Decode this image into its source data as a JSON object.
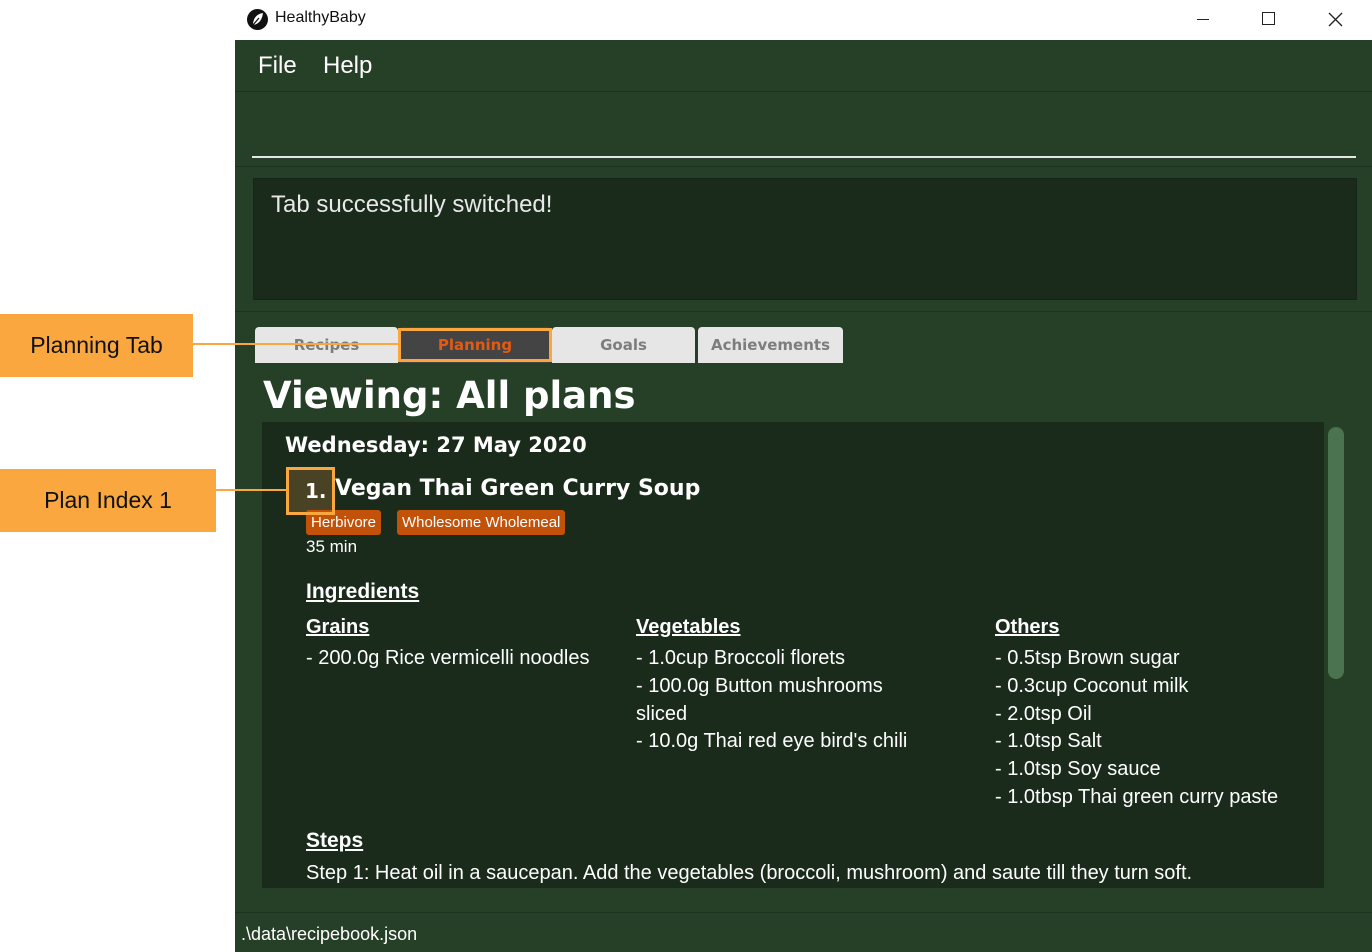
{
  "window": {
    "title": "HealthyBaby",
    "icon": "leaf-icon"
  },
  "menu": {
    "file": "File",
    "help": "Help"
  },
  "command": {
    "value": ""
  },
  "result": {
    "message": "Tab successfully switched!"
  },
  "tabs": [
    {
      "label": "Recipes",
      "selected": false
    },
    {
      "label": "Planning",
      "selected": true
    },
    {
      "label": "Goals",
      "selected": false
    },
    {
      "label": "Achievements",
      "selected": false
    }
  ],
  "view": {
    "title": "Viewing: All plans"
  },
  "plan": {
    "date": "Wednesday: 27 May 2020",
    "index": "1.",
    "recipe_name": "Vegan Thai Green Curry Soup",
    "tags": [
      "Herbivore",
      "Wholesome Wholemeal"
    ],
    "time": "35 min",
    "ingredients_heading": "Ingredients",
    "columns": {
      "grains": {
        "heading": "Grains",
        "items": [
          "- 200.0g Rice vermicelli noodles"
        ]
      },
      "vegetables": {
        "heading": "Vegetables",
        "items": [
          "- 1.0cup Broccoli florets",
          "- 100.0g Button mushrooms sliced",
          "- 10.0g Thai red eye bird's chili"
        ]
      },
      "others": {
        "heading": "Others",
        "items": [
          "- 0.5tsp Brown sugar",
          "- 0.3cup Coconut milk",
          "- 2.0tsp Oil",
          "- 1.0tsp Salt",
          "- 1.0tsp Soy sauce",
          "- 1.0tbsp Thai green curry paste"
        ]
      }
    },
    "steps_heading": "Steps",
    "steps": [
      "Step 1: Heat oil in a saucepan. Add the vegetables (broccoli, mushroom) and saute till they turn soft."
    ]
  },
  "status": {
    "path": ".\\data\\recipebook.json"
  },
  "annotations": {
    "planning_tab": "Planning Tab",
    "plan_index": "Plan Index 1"
  },
  "colors": {
    "background": "#264028",
    "panel": "#1a2a1b",
    "tag": "#c25209",
    "selected_tab_text": "#e35b12",
    "annotation": "#f9a73e"
  }
}
